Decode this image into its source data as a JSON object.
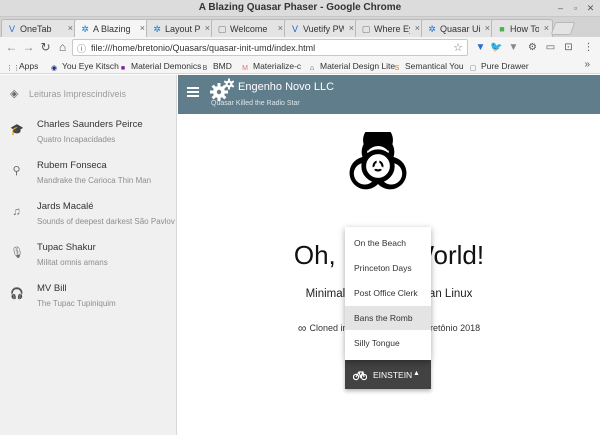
{
  "window": {
    "title": "A Blazing Quasar Phaser - Google Chrome"
  },
  "tabs": [
    {
      "label": "OneTab",
      "icon": "onetab-icon",
      "color": "#2b6cd4",
      "glyph": "V"
    },
    {
      "label": "A Blazing",
      "icon": "quasar-icon",
      "color": "#1976d2",
      "glyph": "✲",
      "active": true
    },
    {
      "label": "Layout Pa",
      "icon": "quasar-icon",
      "color": "#1976d2",
      "glyph": "✲"
    },
    {
      "label": "Welcome",
      "icon": "page-icon",
      "color": "#777777",
      "glyph": "▢"
    },
    {
      "label": "Vuetify PW",
      "icon": "vuetify-icon",
      "color": "#1867c0",
      "glyph": "V"
    },
    {
      "label": "Where Ey",
      "icon": "page-icon",
      "color": "#777777",
      "glyph": "▢"
    },
    {
      "label": "Quasar Ui",
      "icon": "quasar-icon",
      "color": "#1976d2",
      "glyph": "✲"
    },
    {
      "label": "How To C",
      "icon": "green-icon",
      "color": "#4caf50",
      "glyph": "■"
    }
  ],
  "toolbar": {
    "url": "file:///home/bretonio/Quasars/quasar-init-umd/index.html"
  },
  "bookmarks": [
    {
      "label": "Apps",
      "icon": "apps-icon",
      "color": "#444444",
      "glyph": "⋮⋮"
    },
    {
      "label": "You Eye Kitsch",
      "icon": "kitsch-icon",
      "color": "#1a237e",
      "glyph": "◉"
    },
    {
      "label": "Material Demonics",
      "icon": "material-icon",
      "color": "#7b1fa2",
      "glyph": "■"
    },
    {
      "label": "BMD",
      "icon": "bmd-icon",
      "color": "#4a4a6a",
      "glyph": "B"
    },
    {
      "label": "Materialize-c",
      "icon": "materialize-icon",
      "color": "#ee6e73",
      "glyph": "M"
    },
    {
      "label": "Material Design Lite",
      "icon": "mdl-icon",
      "color": "#333333",
      "glyph": "⌂"
    },
    {
      "label": "Semantical You",
      "icon": "semantic-icon",
      "color": "#ef6c00",
      "glyph": "S"
    },
    {
      "label": "Pure Drawer",
      "icon": "page-icon",
      "color": "#777777",
      "glyph": "▢"
    }
  ],
  "sidebar": {
    "header": "Leituras Imprescindíveis",
    "items": [
      {
        "title": "Charles Saunders Peirce",
        "sub": "Quatro Incapacidades",
        "icon": "school-icon",
        "glyph": "🎓"
      },
      {
        "title": "Rubem Fonseca",
        "sub": "Mandrake the Carioca Thin Man",
        "icon": "search-icon",
        "glyph": "⚲"
      },
      {
        "title": "Jards Macalé",
        "sub": "Sounds of deepest darkest São Pavlov",
        "icon": "playlist-icon",
        "glyph": "♫"
      },
      {
        "title": "Tupac Shakur",
        "sub": "Militat omnis amans",
        "icon": "mic-icon",
        "glyph": "🎙"
      },
      {
        "title": "MV Bill",
        "sub": "The Tupac Tupiniquim",
        "icon": "headset-icon",
        "glyph": "🎧"
      }
    ]
  },
  "appbar": {
    "title": "Engenho Novo LLC",
    "subtitle": "Quasar Killed the Radio Star"
  },
  "content": {
    "hello": "Oh, Hello World!",
    "subtitle": "Minimal Quasar on Debian Linux",
    "cloned": "Cloned in Engenho Novo by Bretônio 2018"
  },
  "dropdown": {
    "items": [
      "On the Beach",
      "Princeton Days",
      "Post Office Clerk",
      "Bans the Romb",
      "Silly Tongue"
    ],
    "hovered_index": 3,
    "button_label": "EINSTEIN"
  },
  "colors": {
    "appbar": "#607d8b",
    "dropdown_button": "#424242"
  }
}
